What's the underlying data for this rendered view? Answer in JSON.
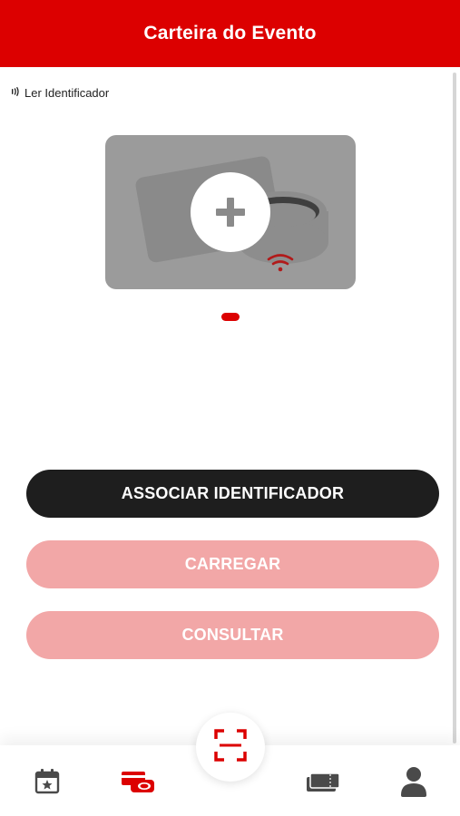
{
  "header": {
    "title": "Carteira do Evento"
  },
  "reader": {
    "label": "Ler Identificador",
    "icon": "nfc-signal-icon"
  },
  "carousel": {
    "slides": [
      {
        "illustration": "card-and-ring-placeholder",
        "action_icon": "plus-icon"
      }
    ],
    "active_index": 0
  },
  "actions": {
    "associate_label": "ASSOCIAR IDENTIFICADOR",
    "load_label": "CARREGAR",
    "check_label": "CONSULTAR"
  },
  "bottom_nav": {
    "items": [
      {
        "icon": "calendar-star-icon",
        "active": false
      },
      {
        "icon": "wallet-cards-icon",
        "active": true
      },
      {
        "icon": "qr-scan-icon",
        "active": false
      },
      {
        "icon": "tickets-icon",
        "active": false
      },
      {
        "icon": "user-icon",
        "active": false
      }
    ]
  },
  "colors": {
    "brand_red": "#dc0000",
    "dark_button": "#1e1e1e",
    "disabled_button": "#f2a7a7",
    "icon_gray": "#4a4a4a"
  }
}
